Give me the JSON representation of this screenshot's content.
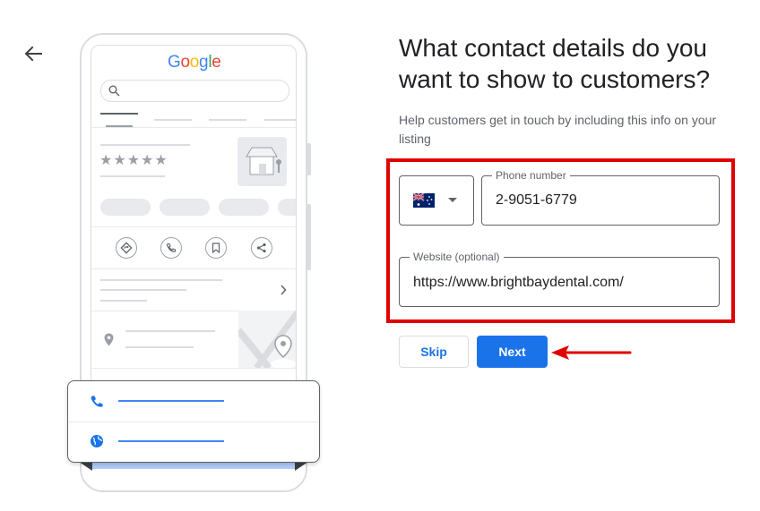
{
  "nav": {
    "back_icon": "arrow-left-icon"
  },
  "illustration": {
    "brand": "Google",
    "rating": "★★★★★",
    "icons": [
      "search-icon",
      "store-icon",
      "directions-icon",
      "phone-icon",
      "bookmark-icon",
      "share-icon",
      "chevron-right-icon",
      "location-pin-icon",
      "map-pin-icon",
      "phone-icon",
      "globe-icon"
    ]
  },
  "page": {
    "heading": "What contact details do you want to show to customers?",
    "subtext": "Help customers get in touch by including this info on your listing"
  },
  "form": {
    "country_flag_icon": "australia-flag-icon",
    "phone_label": "Phone number",
    "phone_value": "2-9051-6779",
    "website_label": "Website (optional)",
    "website_value": "https://www.brightbaydental.com/"
  },
  "actions": {
    "skip_label": "Skip",
    "next_label": "Next"
  },
  "colors": {
    "accent": "#1a73e8",
    "highlight": "#e00000"
  }
}
